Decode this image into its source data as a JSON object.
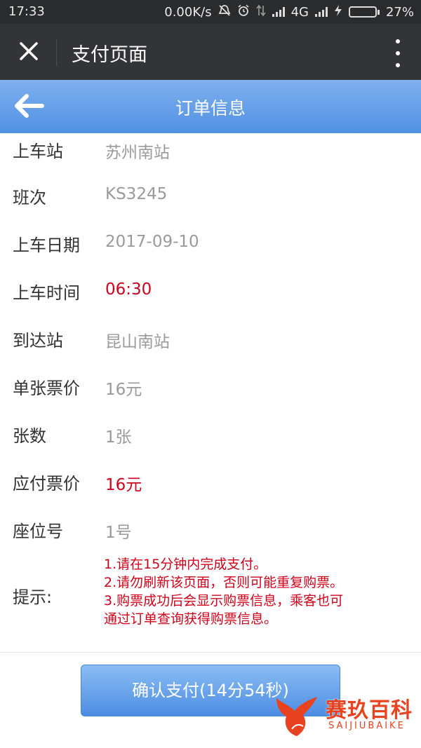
{
  "status_bar": {
    "time": "17:33",
    "speed": "0.00K/s",
    "network": "4G",
    "battery": "27%",
    "battery_level": 0.27,
    "icons": [
      "mute-icon",
      "alarm-icon",
      "data-arrows-icon",
      "signal-icon",
      "signal-icon",
      "charging-icon",
      "battery-icon"
    ]
  },
  "title_bar": {
    "title": "支付页面"
  },
  "page_header": {
    "title": "订单信息"
  },
  "order": [
    {
      "label": "上车站",
      "value": "苏州南站",
      "highlight": false
    },
    {
      "label": "班次",
      "value": "KS3245",
      "highlight": false
    },
    {
      "label": "上车日期",
      "value": "2017-09-10",
      "highlight": false
    },
    {
      "label": "上车时间",
      "value": "06:30",
      "highlight": true
    },
    {
      "label": "到达站",
      "value": "昆山南站",
      "highlight": false
    },
    {
      "label": "单张票价",
      "value": "16元",
      "highlight": false
    },
    {
      "label": "张数",
      "value": "1张",
      "highlight": false
    },
    {
      "label": "应付票价",
      "value": "16元",
      "highlight": true
    },
    {
      "label": "座位号",
      "value": "1号",
      "highlight": false
    }
  ],
  "tips": {
    "label": "提示:",
    "lines": [
      "1.请在15分钟内完成支付。",
      "2.请勿刷新该页面，否则可能重复购票。",
      "3.购票成功后会显示购票信息，乘客也可",
      "通过订单查询获得购票信息。"
    ]
  },
  "confirm_button": {
    "label": "确认支付(14分54秒)"
  },
  "watermark": {
    "brand": "赛玖百科",
    "sub": "SAIJIUBAIKE"
  },
  "colors": {
    "status_bar": "#2a2b2d",
    "title_bar": "#333437",
    "header_blue": "#5b9ae6",
    "highlight_red": "#d0021b",
    "value_gray": "#9a9a9a",
    "watermark_orange": "#e8421e"
  }
}
